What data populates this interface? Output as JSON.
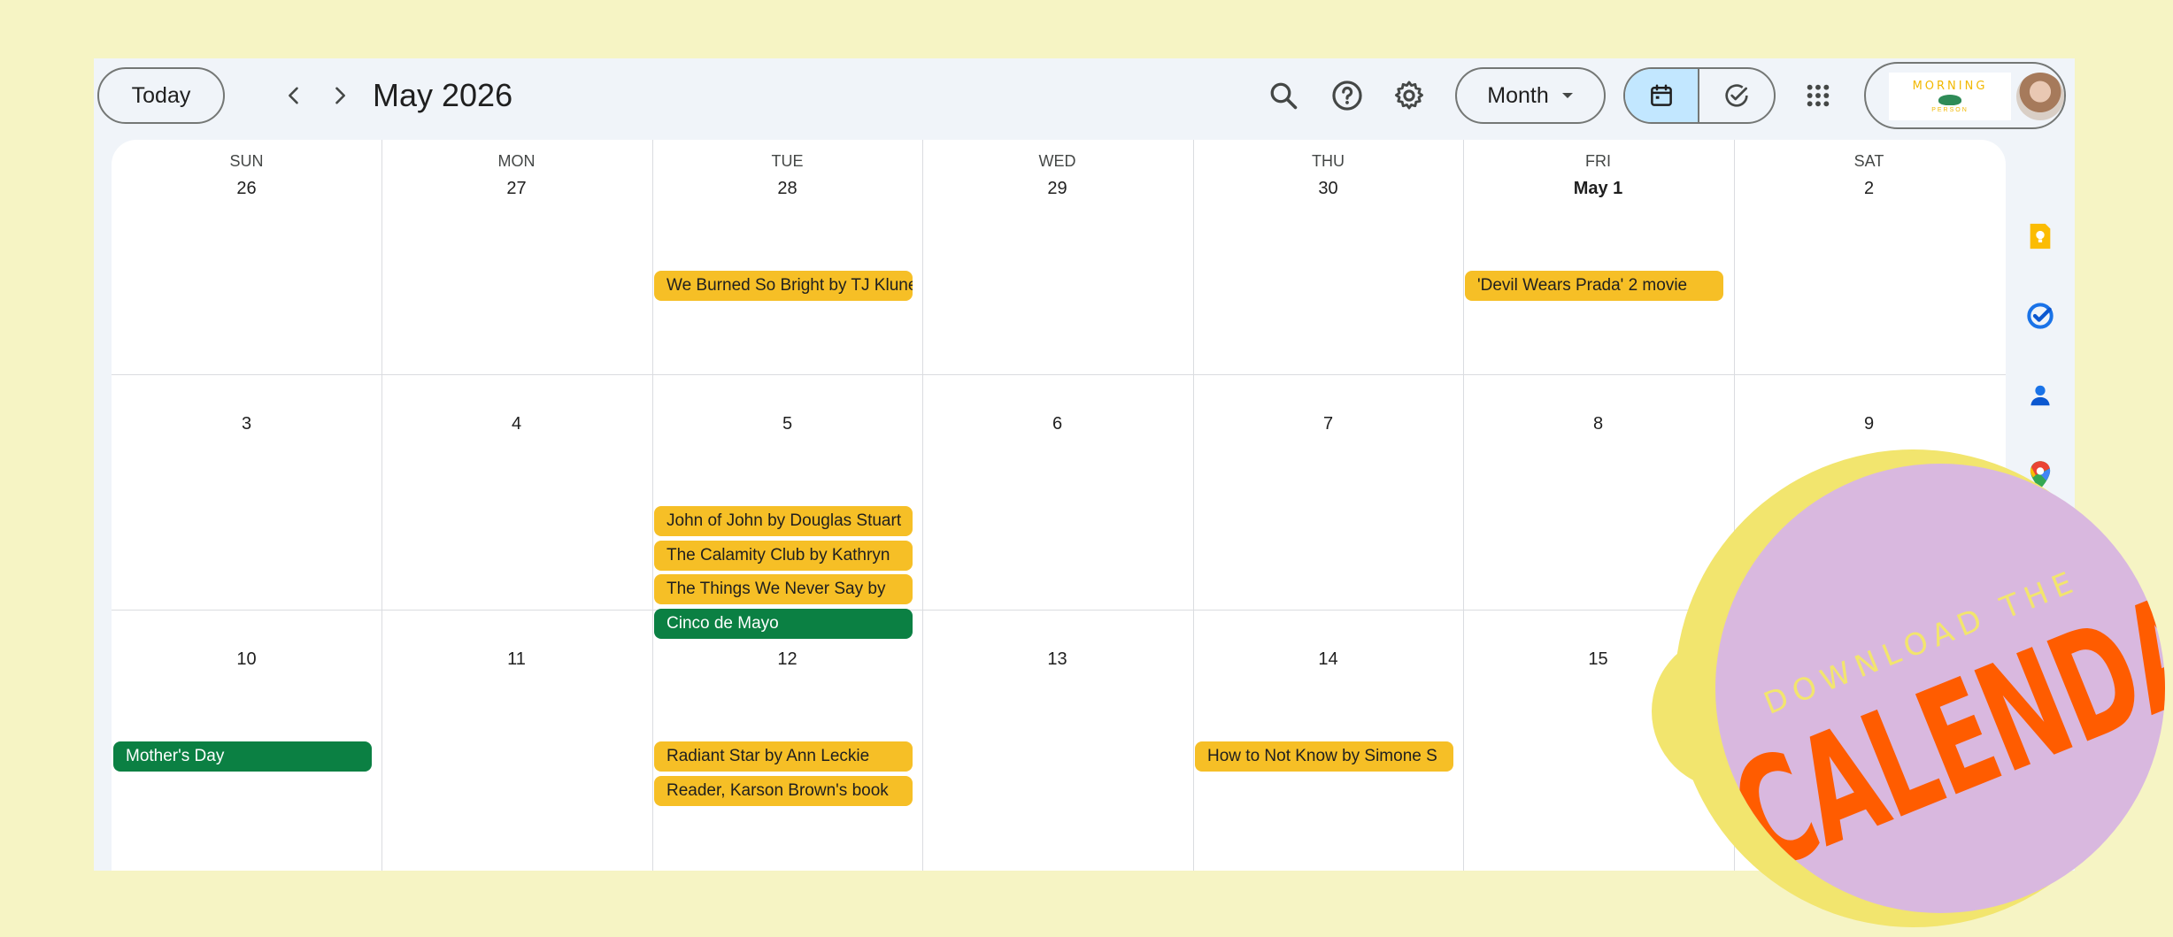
{
  "toolbar": {
    "today_label": "Today",
    "title": "May 2026",
    "view_label": "Month",
    "account_logo_word": "MORNING",
    "account_logo_sub": "PERSON"
  },
  "calendar": {
    "weekdays": [
      "SUN",
      "MON",
      "TUE",
      "WED",
      "THU",
      "FRI",
      "SAT"
    ],
    "weeks": [
      [
        "26",
        "27",
        "28",
        "29",
        "30",
        "May 1",
        "2"
      ],
      [
        "3",
        "4",
        "5",
        "6",
        "7",
        "8",
        "9"
      ],
      [
        "10",
        "11",
        "12",
        "13",
        "14",
        "15",
        ""
      ]
    ],
    "events": {
      "w1_tue": [
        "We Burned So Bright by TJ Klune"
      ],
      "w1_fri": [
        "'Devil Wears Prada' 2 movie"
      ],
      "w2_tue": [
        "John of John by Douglas Stuart",
        "The Calamity Club by Kathryn",
        "The Things We Never Say by",
        "Cinco de Mayo"
      ],
      "w3_sun": [
        "Mother's Day"
      ],
      "w3_tue": [
        "Radiant Star by Ann Leckie",
        "Reader, Karson Brown's book"
      ],
      "w3_thu": [
        "How to Not Know by Simone S"
      ]
    }
  },
  "colors": {
    "event_yellow": "#f6bf26",
    "event_green": "#0b8043",
    "page_background": "#f6f4c4",
    "badge_purple": "#d9b8df",
    "badge_orange": "#ff5c00"
  },
  "side_panel": {
    "icons": [
      "keep-icon",
      "tasks-icon",
      "contacts-icon",
      "maps-icon"
    ]
  },
  "badge": {
    "line1": "DOWNLOAD THE",
    "line2": "CALENDAR"
  }
}
